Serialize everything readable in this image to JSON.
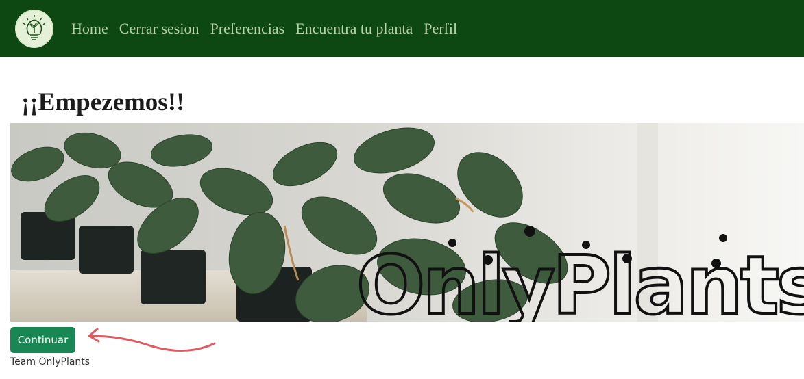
{
  "navbar": {
    "logo_icon": "plant-lightbulb-icon",
    "links": [
      "Home",
      "Cerrar sesion",
      "Preferencias",
      "Encuentra tu planta",
      "Perfil"
    ]
  },
  "main": {
    "title": "¡¡Empezemos!!",
    "hero_logo_text": "OnlyPlants",
    "continue_label": "Continuar",
    "footer": "Team OnlyPlants"
  },
  "colors": {
    "navbar": "#0d4712",
    "nav_link": "#b8d3a8",
    "button": "#198754",
    "arrow": "#e05a5f"
  }
}
